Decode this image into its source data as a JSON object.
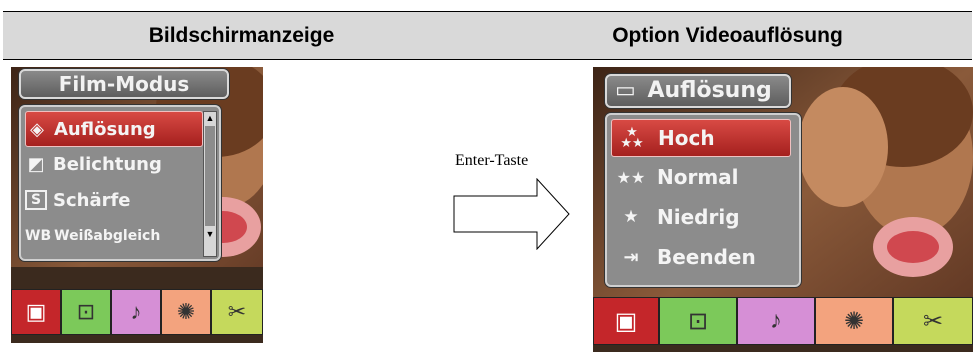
{
  "header": {
    "left_title": "Bildschirmanzeige",
    "right_title": "Option Videoauflösung"
  },
  "left_screen": {
    "menu_title": "Film-Modus",
    "items": [
      {
        "icon": "resolution-icon",
        "label": "Auflösung",
        "selected": true
      },
      {
        "icon": "exposure-icon",
        "label": "Belichtung",
        "selected": false
      },
      {
        "icon_text": "S",
        "label": "Schärfe",
        "selected": false
      },
      {
        "icon_text": "WB",
        "label": "Weißabgleich",
        "selected": false
      }
    ],
    "tabs": [
      {
        "icon": "video-camera-icon",
        "color": "#c4262a"
      },
      {
        "icon": "camera-icon",
        "color": "#7cc95a"
      },
      {
        "icon": "microphone-icon",
        "color": "#d68fd6"
      },
      {
        "icon": "palette-icon",
        "color": "#f3a37e"
      },
      {
        "icon": "tools-icon",
        "color": "#c5d95c"
      }
    ]
  },
  "arrow": {
    "label": "Enter-Taste"
  },
  "right_screen": {
    "menu_title": "Auflösung",
    "items": [
      {
        "icon": "three-stars-icon",
        "label": "Hoch",
        "selected": true
      },
      {
        "icon": "two-stars-icon",
        "label": "Normal",
        "selected": false
      },
      {
        "icon": "one-star-icon",
        "label": "Niedrig",
        "selected": false
      },
      {
        "icon": "exit-door-icon",
        "label": "Beenden",
        "selected": false
      }
    ],
    "tabs": [
      {
        "icon": "video-camera-icon",
        "color": "#c4262a"
      },
      {
        "icon": "camera-icon",
        "color": "#7cc95a"
      },
      {
        "icon": "microphone-icon",
        "color": "#d68fd6"
      },
      {
        "icon": "palette-icon",
        "color": "#f3a37e"
      },
      {
        "icon": "tools-icon",
        "color": "#c5d95c"
      }
    ]
  }
}
